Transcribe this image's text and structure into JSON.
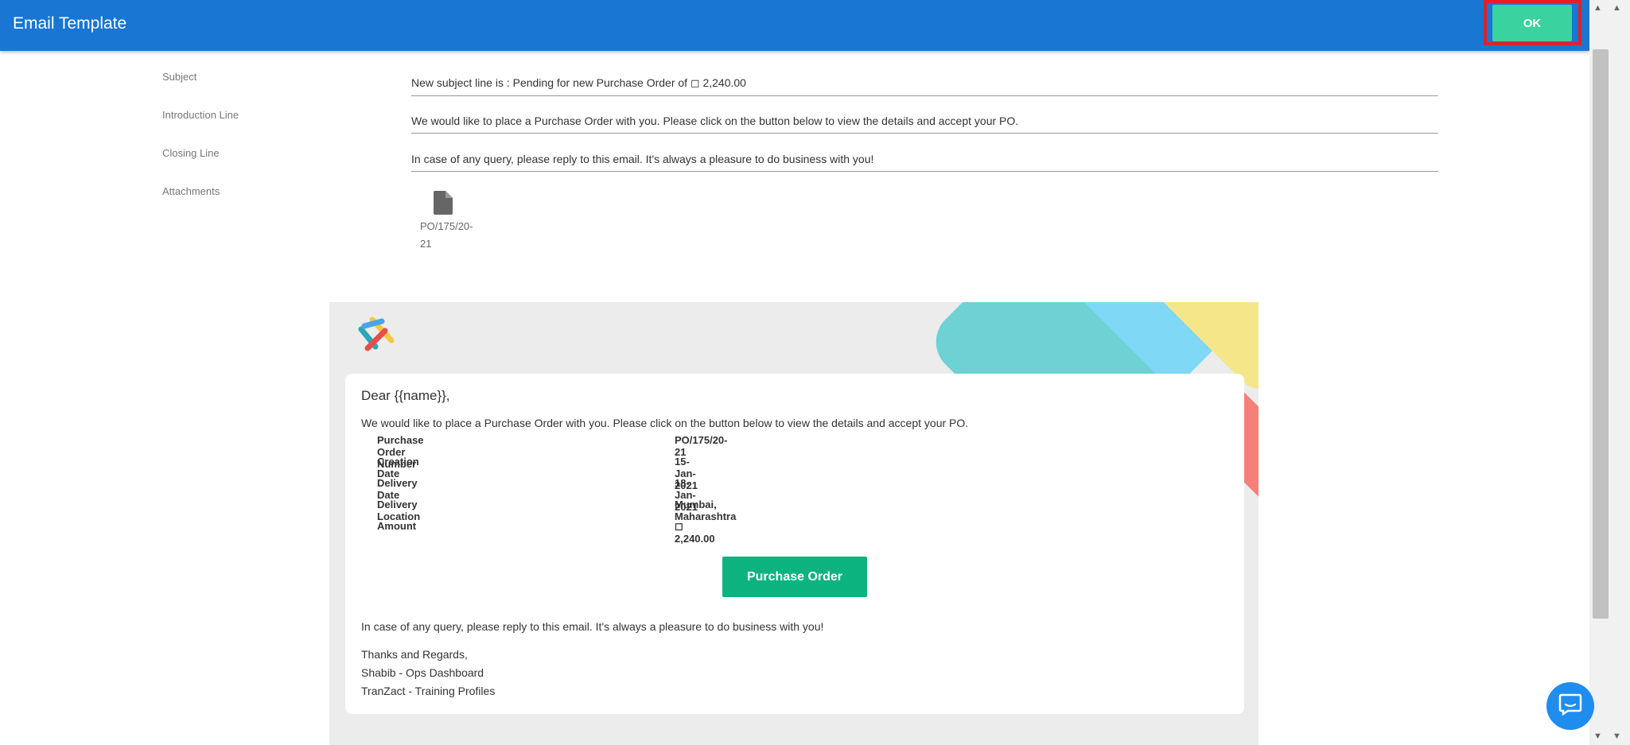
{
  "header": {
    "title": "Email Template",
    "ok_label": "OK"
  },
  "form": {
    "subject_label": "Subject",
    "subject_value": "New subject line is : Pending for new Purchase Order of ◻ 2,240.00",
    "intro_label": "Introduction Line",
    "intro_value": "We would like to place a Purchase Order with you. Please click on the button below to view the details and accept your PO.",
    "closing_label": "Closing Line",
    "closing_value": "In case of any query, please reply to this email. It's always a pleasure to do business with you!",
    "attachments_label": "Attachments",
    "attachment_name": "PO/175/20-21",
    "attachment_icon": "file-icon"
  },
  "preview": {
    "greeting": "Dear {{name}},",
    "intro": "We would like to place a Purchase Order with you. Please click on the button below to view the details and accept your PO.",
    "details": [
      {
        "label": "Purchase Order Number",
        "value": "PO/175/20-21"
      },
      {
        "label": "Creation Date",
        "value": "15-Jan-2021"
      },
      {
        "label": "Delivery Date",
        "value": "18-Jan-2021"
      },
      {
        "label": "Delivery Location",
        "value": "Mumbai, Maharashtra"
      },
      {
        "label": "Amount",
        "value": "◻ 2,240.00"
      }
    ],
    "button_label": "Purchase Order",
    "closing": "In case of any query, please reply to this email. It's always a pleasure to do business with you!",
    "signature_line1": "Thanks and Regards,",
    "signature_line2": "Shabib - Ops Dashboard",
    "signature_line3": "TranZact - Training Profiles"
  },
  "colors": {
    "header": "#1976d2",
    "ok_button": "#3ad29f",
    "po_button": "#0db37f",
    "highlight": "#e0202a",
    "chat": "#1f8ded"
  },
  "icons": {
    "scroll_up": "triangle-up-icon",
    "scroll_down": "triangle-down-icon",
    "chat": "chat-icon",
    "logo": "tranzact-logo"
  }
}
